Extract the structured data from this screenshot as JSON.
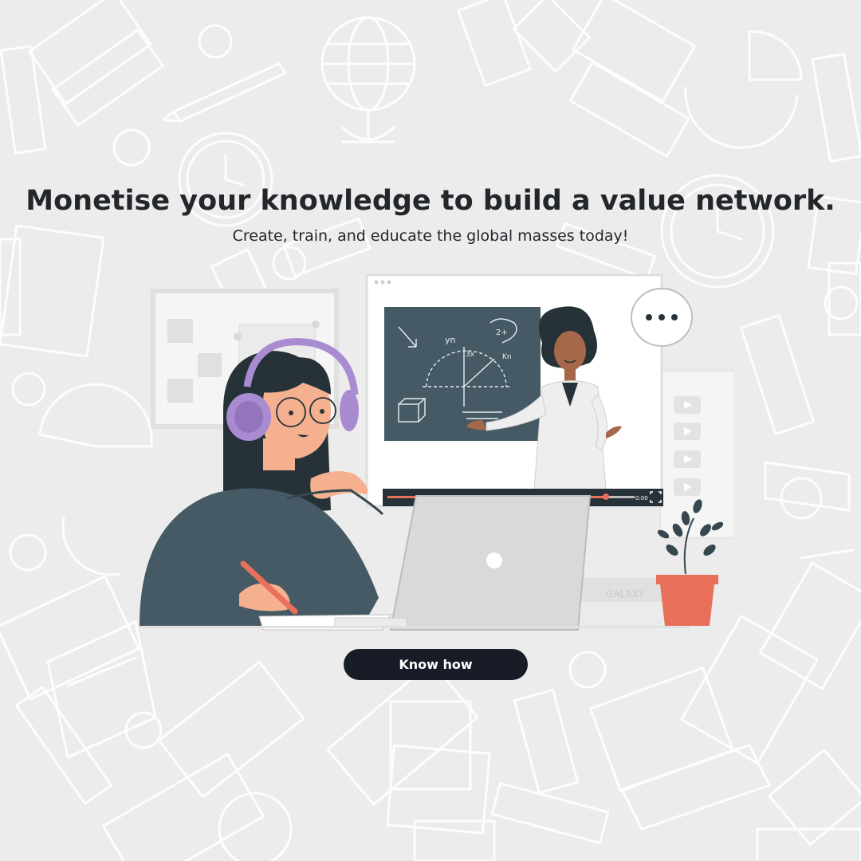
{
  "hero": {
    "title": "Monetise your knowledge to build a value network.",
    "subtitle": "Create, train, and educate the global masses today!"
  },
  "video": {
    "time": "0:00",
    "board_text": [
      "yn",
      "2+",
      "3x",
      "Kn"
    ],
    "book_spine": "GALAXY"
  },
  "cta": {
    "label": "Know how"
  },
  "colors": {
    "background": "#ececec",
    "text": "#23262b",
    "button": "#171c26",
    "button_text": "#ffffff",
    "headphones": "#a88bd0",
    "sweater": "#455a64",
    "pot": "#e8705a",
    "chalkboard": "#455a64"
  },
  "icons": [
    "globe-icon",
    "laptop-icon",
    "pencil-icon",
    "clock-icon",
    "ruler-icon",
    "book-icon",
    "fullscreen-icon",
    "speech-bubble-icon"
  ]
}
